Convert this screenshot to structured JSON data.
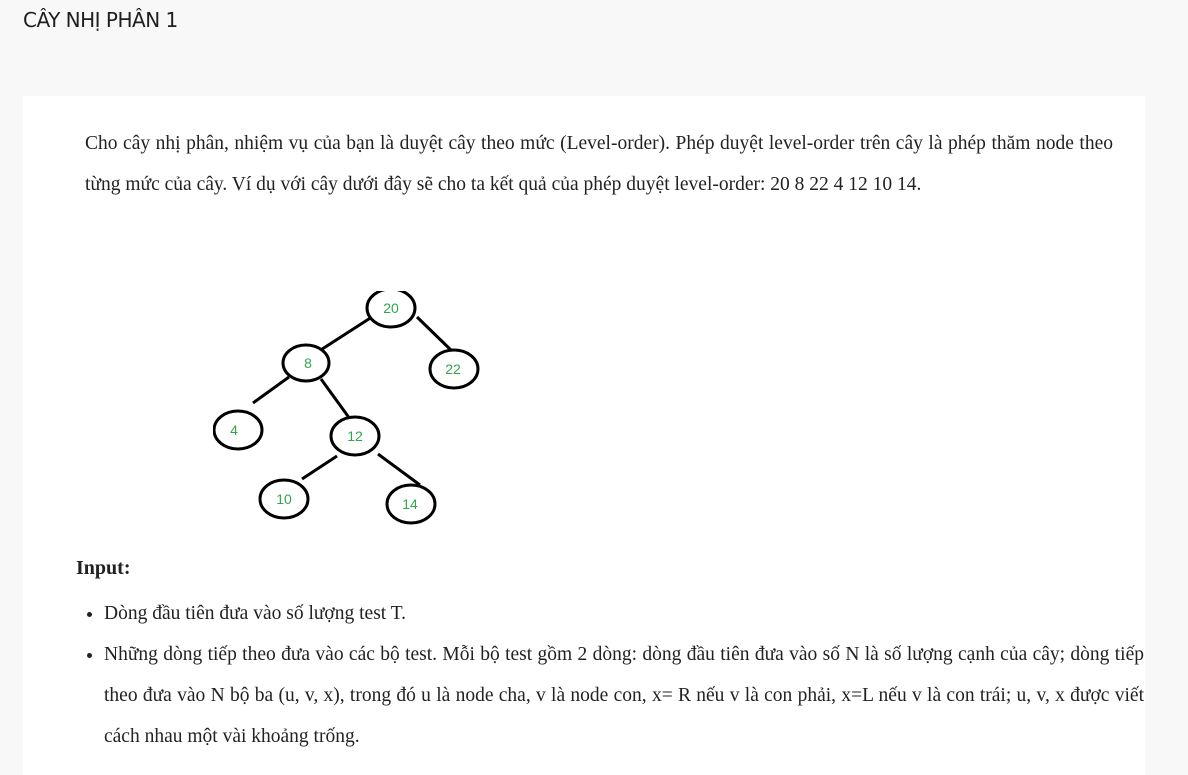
{
  "page": {
    "title": "CÂY NHỊ PHÂN 1"
  },
  "problem": {
    "description": "Cho cây nhị phân, nhiệm vụ của bạn là duyệt cây theo mức (Level-order). Phép duyệt level-order trên cây là phép thăm node theo từng mức của cây. Ví dụ với cây dưới đây sẽ cho ta kết quả của phép duyệt level-order: 20  8  22  4  12  10  14.",
    "tree": {
      "nodes": [
        "20",
        "8",
        "22",
        "4",
        "12",
        "10",
        "14"
      ]
    },
    "input_heading": "Input:",
    "input_items": [
      "Dòng đầu tiên đưa vào số lượng test T.",
      "Những dòng tiếp theo đưa vào các bộ test. Mỗi bộ test gồm 2 dòng: dòng đầu tiên đưa vào số N là số lượng cạnh của cây; dòng tiếp theo đưa vào N bộ ba (u, v, x), trong đó u là node cha, v là node con, x= R nếu v là con phải, x=L nếu v là con trái; u, v, x được viết cách nhau một vài khoảng trống."
    ]
  },
  "colors": {
    "node_label": "#2ea84a",
    "edge": "#000000"
  }
}
